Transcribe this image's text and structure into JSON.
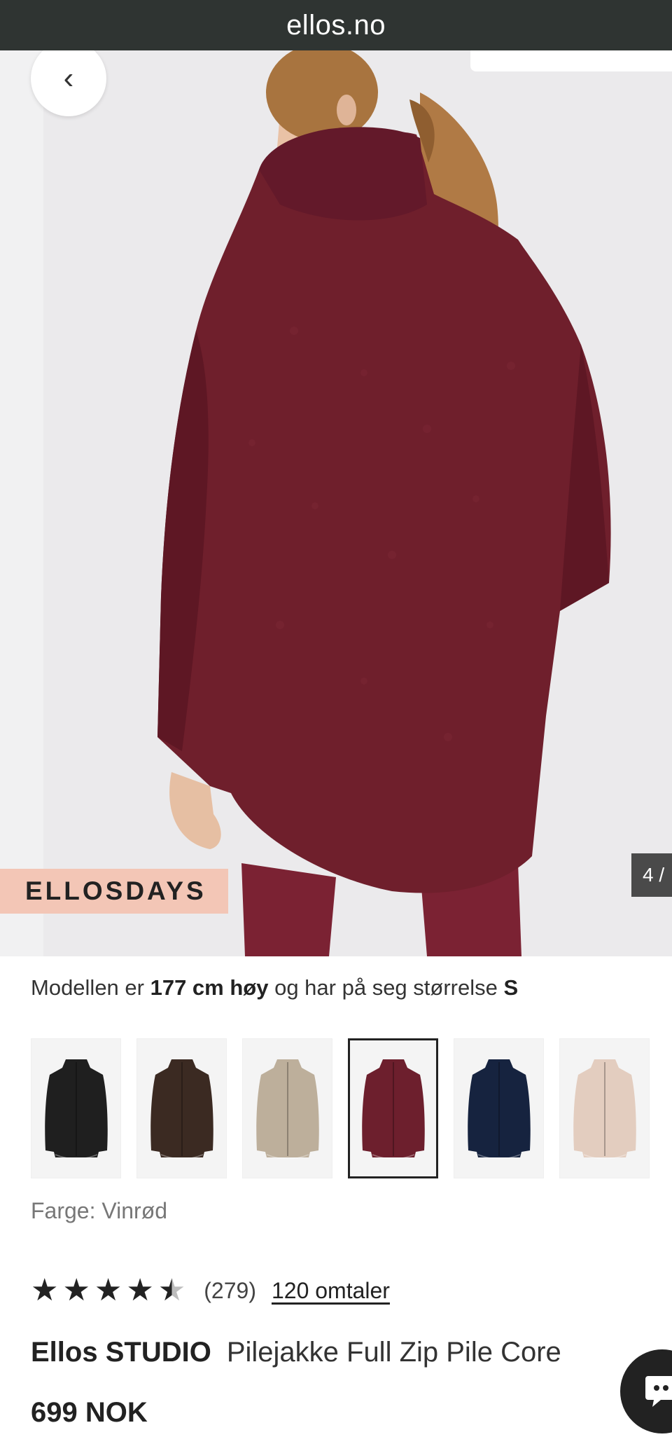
{
  "browser": {
    "url": "ellos.no"
  },
  "hero": {
    "back_icon": "chevron-left-icon",
    "promo_tag": "ELLOSDAYS",
    "image_counter": "4 /"
  },
  "model_info": {
    "prefix": "Modellen er ",
    "height": "177 cm høy",
    "middle": " og har på seg størrelse ",
    "size": "S"
  },
  "swatches": [
    {
      "color_name": "black",
      "hex": "#1f1f1f",
      "selected": false
    },
    {
      "color_name": "brown",
      "hex": "#3b2a22",
      "selected": false
    },
    {
      "color_name": "beige",
      "hex": "#bdaf9b",
      "selected": false
    },
    {
      "color_name": "wine-red",
      "hex": "#6d1f2d",
      "selected": true
    },
    {
      "color_name": "navy",
      "hex": "#16233f",
      "selected": false
    },
    {
      "color_name": "pink",
      "hex": "#e3cdbf",
      "selected": false
    }
  ],
  "color_label": "Farge: Vinrød",
  "rating": {
    "stars": 4.5,
    "count": "(279)",
    "reviews_link": "120 omtaler"
  },
  "product": {
    "brand": "Ellos STUDIO",
    "name": "Pilejakke Full Zip Pile Core",
    "price": "699 NOK"
  },
  "colors": {
    "jacket": "#6f1f2c",
    "jacket_shadow": "#571722",
    "background": "#ebeaec",
    "promo": "#f3c6b6",
    "hair": "#b07a45"
  }
}
